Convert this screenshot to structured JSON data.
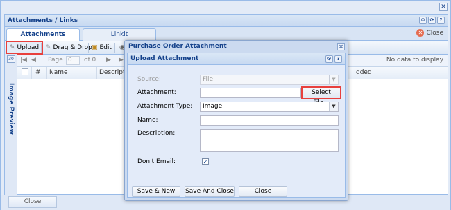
{
  "window": {
    "close_glyph": "✕"
  },
  "panel": {
    "title": "Attachments / Links",
    "tabs": [
      {
        "label": "Attachments",
        "active": true
      },
      {
        "label": "Linkit",
        "active": false
      }
    ],
    "close_label": "Close",
    "side_label": "Image Preview",
    "side_num": "30",
    "no_data": "No data to display",
    "col_added": "dded"
  },
  "toolbar": {
    "upload": "Upload",
    "drag_drop": "Drag & Drop",
    "edit": "Edit"
  },
  "pager": {
    "page_label": "Page",
    "page_value": "0",
    "of": "of 0"
  },
  "grid": {
    "col_num": "#",
    "col_name": "Name",
    "col_desc": "Description"
  },
  "footer": {
    "close": "Close"
  },
  "modal": {
    "title": "Purchase Order Attachment",
    "subtitle": "Upload Attachment",
    "fields": {
      "source_label": "Source:",
      "source_value": "File",
      "attachment_label": "Attachment:",
      "select_file": "Select File...",
      "type_label": "Attachment Type:",
      "type_value": "Image",
      "name_label": "Name:",
      "desc_label": "Description:",
      "dont_email_label": "Don't Email:",
      "dont_email_checked": true
    },
    "buttons": {
      "save_new": "Save & New",
      "save_close": "Save And Close",
      "close": "Close"
    }
  },
  "colors": {
    "highlight": "#e8403d",
    "brand": "#15428b"
  }
}
